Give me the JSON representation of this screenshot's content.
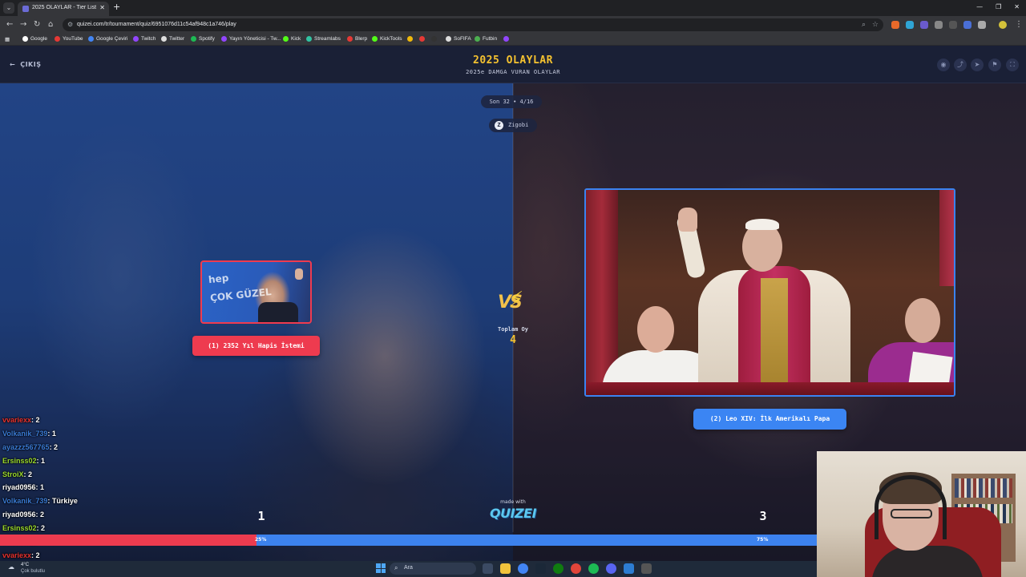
{
  "browser": {
    "tab_title": "2025 OLAYLAR - Tier List, Kör S",
    "url": "quizei.com/tr/tournament/quiz/6951076d11c54af948c1a746/play",
    "bookmarks": [
      "Google",
      "YouTube",
      "Google Çeviri",
      "Twitch",
      "Twitter",
      "Spotify",
      "Yayın Yöneticisi - Tw...",
      "Kick",
      "Streamlabs",
      "Blerp",
      "KickTools",
      "SoFIFA",
      "Futbin"
    ]
  },
  "header": {
    "exit_label": "ÇIKIŞ",
    "title": "2025 OLAYLAR",
    "subtitle": "2025e DAMGA VURAN OLAYLAR"
  },
  "round": {
    "label": "Son 32 • 4/16",
    "creator": "Zigobi",
    "creator_initial": "Z"
  },
  "left_option": {
    "label": "(1) 2352 Yıl Hapis İstemi",
    "score": "1",
    "percent_label": "25%",
    "percent_value": 25,
    "image_text_a": "hep",
    "image_text_b": "ÇOK GÜZEL"
  },
  "right_option": {
    "label": "(2) Leo XIV: İlk Amerikalı Papa",
    "score": "3",
    "percent_label": "75%",
    "percent_value": 75
  },
  "vs": {
    "label": "VS",
    "total_label": "Toplam Oy",
    "total_value": "4"
  },
  "branding": {
    "made_with": "made with",
    "logo": "QUIZEI"
  },
  "chat": [
    {
      "user": "vvariexx",
      "msg": ": 2",
      "color": "#e8322f"
    },
    {
      "user": "Volkanik_739",
      "msg": ": 1",
      "color": "#3a7bd5"
    },
    {
      "user": "ayazzz567765",
      "msg": ": 2",
      "color": "#3a7bd5"
    },
    {
      "user": "Ersinss02",
      "msg": ": 1",
      "color": "#9bd92c"
    },
    {
      "user": "StroiX",
      "msg": ": 2",
      "color": "#9bd92c"
    },
    {
      "user": "riyad0956",
      "msg": ": 1",
      "color": "#ffffff"
    },
    {
      "user": "Volkanik_739",
      "msg": ": Türkiye",
      "color": "#3a7bd5"
    },
    {
      "user": "riyad0956",
      "msg": ": 2",
      "color": "#ffffff"
    },
    {
      "user": "Ersinss02",
      "msg": ": 2",
      "color": "#9bd92c"
    },
    {
      "user": "Volkanik_739",
      "msg": ": 1",
      "color": "#3a7bd5"
    },
    {
      "user": "vvariexx",
      "msg": ": 2",
      "color": "#e8322f"
    }
  ],
  "taskbar": {
    "temperature": "4°C",
    "weather": "Çok bulutlu",
    "search_placeholder": "Ara"
  },
  "colors": {
    "accent_red": "#ee3b4f",
    "accent_blue": "#3b85f3",
    "title_gold": "#f5c230"
  }
}
